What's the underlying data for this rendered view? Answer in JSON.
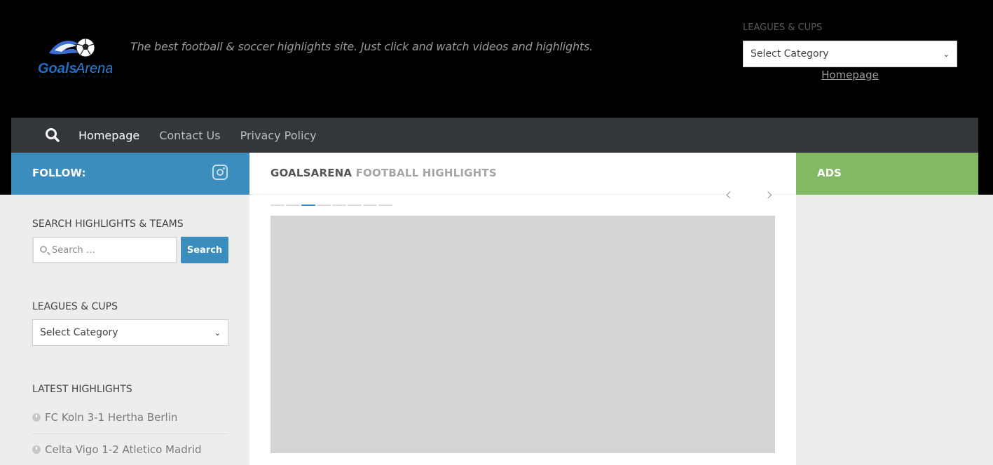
{
  "header": {
    "logo_text": "GoalsArena",
    "tagline": "The best football & soccer highlights site. Just click and watch videos and highlights.",
    "widget_title": "LEAGUES & CUPS",
    "select_value": "Select Category",
    "link": "Homepage"
  },
  "nav": {
    "items": [
      {
        "label": "Homepage"
      },
      {
        "label": "Contact Us"
      },
      {
        "label": "Privacy Policy"
      }
    ]
  },
  "sidebar": {
    "follow_label": "FOLLOW:",
    "search_title": "SEARCH HIGHLIGHTS & TEAMS",
    "search_placeholder": "Search …",
    "search_button": "Search",
    "leagues_title": "LEAGUES & CUPS",
    "leagues_select": "Select Category",
    "latest_title": "LATEST HIGHLIGHTS",
    "highlights": [
      {
        "label": "FC Koln 3-1 Hertha Berlin"
      },
      {
        "label": "Celta Vigo 1-2 Atletico Madrid"
      }
    ]
  },
  "main": {
    "title_main": "GOALSARENA",
    "title_sub": "FOOTBALL HIGHLIGHTS",
    "slider_active_index": 2,
    "slider_count": 8
  },
  "right": {
    "ads_label": "ADS"
  },
  "colors": {
    "accent_blue": "#3b8dbd",
    "ads_green": "#82b965",
    "nav_bg": "#33363b",
    "header_bg": "#000000"
  },
  "icons": {
    "search": "search-icon",
    "instagram": "instagram-icon",
    "prev": "chevron-left-icon",
    "next": "chevron-right-icon"
  }
}
